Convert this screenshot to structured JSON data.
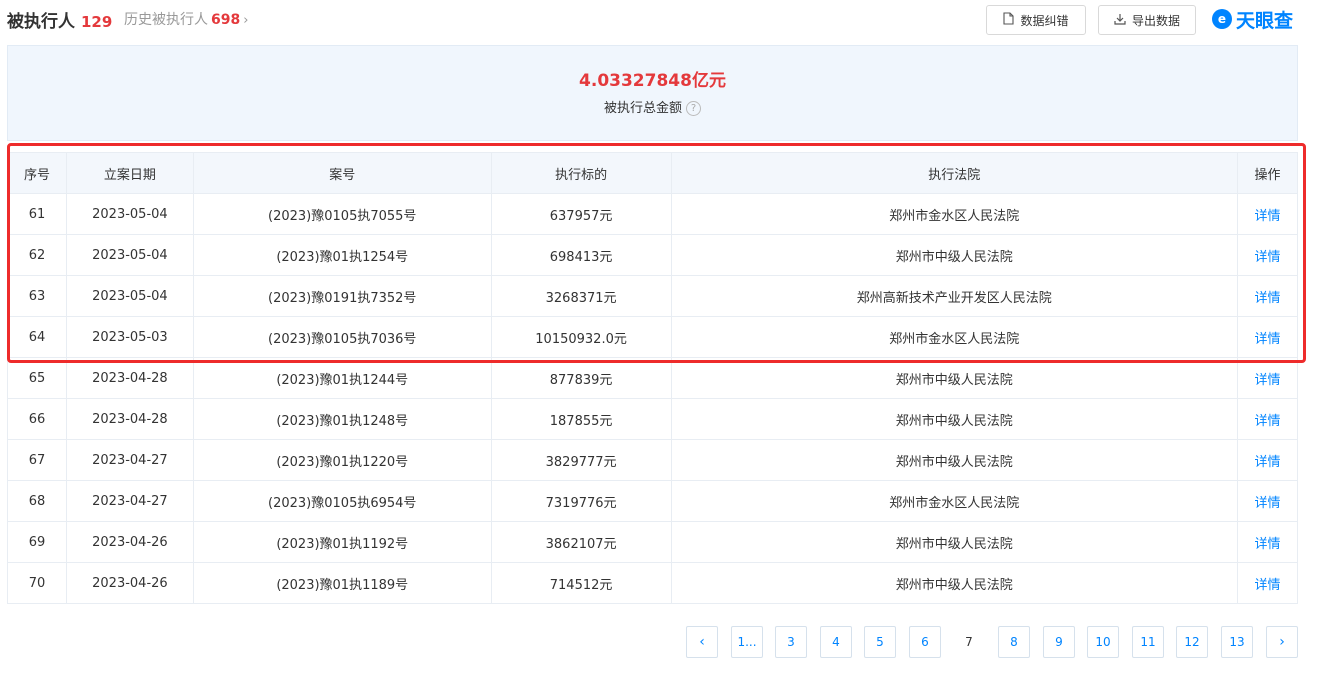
{
  "header": {
    "title": "被执行人",
    "count": "129",
    "history_label": "历史被执行人",
    "history_count": "698",
    "history_chevron": "›",
    "correct_button": "数据纠错",
    "export_button": "导出数据",
    "logo_text": "天眼查",
    "logo_mark": "e"
  },
  "summary": {
    "amount": "4.03327848亿元",
    "label": "被执行总金额",
    "help": "?"
  },
  "table": {
    "headers": [
      "序号",
      "立案日期",
      "案号",
      "执行标的",
      "执行法院",
      "操作"
    ],
    "rows": [
      {
        "no": "61",
        "date": "2023-05-04",
        "case": "(2023)豫0105执7055号",
        "amount": "637957元",
        "court": "郑州市金水区人民法院",
        "action": "详情"
      },
      {
        "no": "62",
        "date": "2023-05-04",
        "case": "(2023)豫01执1254号",
        "amount": "698413元",
        "court": "郑州市中级人民法院",
        "action": "详情"
      },
      {
        "no": "63",
        "date": "2023-05-04",
        "case": "(2023)豫0191执7352号",
        "amount": "3268371元",
        "court": "郑州高新技术产业开发区人民法院",
        "action": "详情"
      },
      {
        "no": "64",
        "date": "2023-05-03",
        "case": "(2023)豫0105执7036号",
        "amount": "10150932.0元",
        "court": "郑州市金水区人民法院",
        "action": "详情"
      },
      {
        "no": "65",
        "date": "2023-04-28",
        "case": "(2023)豫01执1244号",
        "amount": "877839元",
        "court": "郑州市中级人民法院",
        "action": "详情"
      },
      {
        "no": "66",
        "date": "2023-04-28",
        "case": "(2023)豫01执1248号",
        "amount": "187855元",
        "court": "郑州市中级人民法院",
        "action": "详情"
      },
      {
        "no": "67",
        "date": "2023-04-27",
        "case": "(2023)豫01执1220号",
        "amount": "3829777元",
        "court": "郑州市中级人民法院",
        "action": "详情"
      },
      {
        "no": "68",
        "date": "2023-04-27",
        "case": "(2023)豫0105执6954号",
        "amount": "7319776元",
        "court": "郑州市金水区人民法院",
        "action": "详情"
      },
      {
        "no": "69",
        "date": "2023-04-26",
        "case": "(2023)豫01执1192号",
        "amount": "3862107元",
        "court": "郑州市中级人民法院",
        "action": "详情"
      },
      {
        "no": "70",
        "date": "2023-04-26",
        "case": "(2023)豫01执1189号",
        "amount": "714512元",
        "court": "郑州市中级人民法院",
        "action": "详情"
      }
    ]
  },
  "pagination": {
    "prev": "‹",
    "pages": [
      "1...",
      "3",
      "4",
      "5",
      "6",
      "7",
      "8",
      "9",
      "10",
      "11",
      "12",
      "13"
    ],
    "current": "7",
    "next": "›"
  },
  "colors": {
    "accent": "#0084ff",
    "highlight_red": "#e4393c",
    "box_red": "#ee2b2b",
    "summary_bg": "#f0f6fd"
  }
}
